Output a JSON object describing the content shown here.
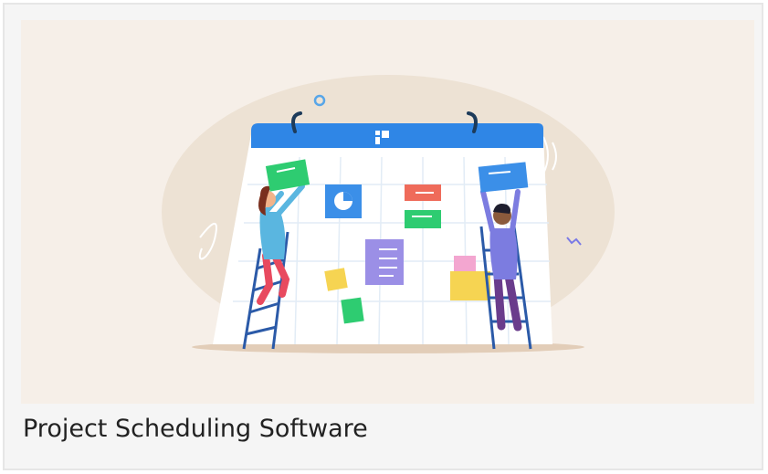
{
  "card": {
    "title": "Project Scheduling Software",
    "image_alt": "Project scheduling illustration: two people on ladders arranging task cards on a large calendar"
  },
  "colors": {
    "card_background": "#f5f5f5",
    "hero_background": "#f6efe8",
    "calendar_header": "#2f86e6",
    "card_green": "#2ecc71",
    "card_red": "#ef6b5a",
    "card_purple": "#9b8fe6",
    "card_yellow": "#f6d452",
    "card_pink": "#f3a6d0",
    "card_blue": "#3b8fe8"
  }
}
